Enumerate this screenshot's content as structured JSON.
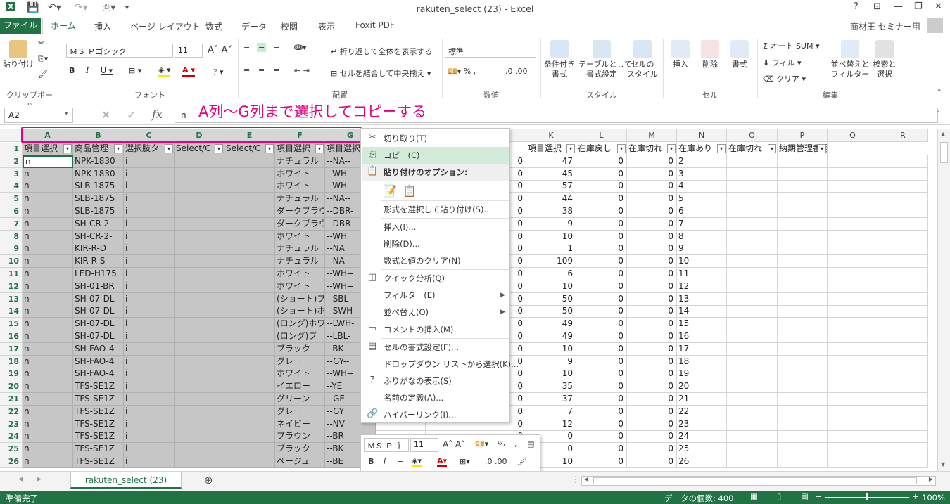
{
  "window": {
    "title": "rakuten_select (23) - Excel",
    "help": "?",
    "user": "商材王 セミナー用"
  },
  "tabs": [
    "ファイル",
    "ホーム",
    "挿入",
    "ページ レイアウト",
    "数式",
    "データ",
    "校閲",
    "表示",
    "Foxit PDF"
  ],
  "ribbon": {
    "paste": "貼り付け",
    "clipboard": "クリップボード",
    "font_name": "ＭＳ Ｐゴシック",
    "font_size": "11",
    "font": "フォント",
    "wrap": "折り返して全体を表示する",
    "merge": "セルを結合して中央揃え",
    "alignment": "配置",
    "number_format": "標準",
    "number": "数値",
    "cond_format": "条件付き\n書式",
    "table_format": "テーブルとして\n書式設定",
    "cell_style": "セルの\nスタイル",
    "styles": "スタイル",
    "insert": "挿入",
    "delete": "削除",
    "format": "書式",
    "cells": "セル",
    "autosum": "オート SUM",
    "fill": "フィル",
    "clear": "クリア",
    "sort": "並べ替えと\nフィルター",
    "find": "検索と\n選択",
    "editing": "編集"
  },
  "formula_bar": {
    "name_box": "A2",
    "value": "n",
    "fx": "fx"
  },
  "annotation": "A列～G列まで選択してコピーする",
  "columns": [
    "A",
    "B",
    "C",
    "D",
    "E",
    "F",
    "G",
    "H",
    "I",
    "J",
    "K",
    "L",
    "M",
    "N",
    "O",
    "P",
    "Q",
    "R"
  ],
  "header_row": [
    "項目選択",
    "商品管理",
    "選択肢タ",
    "Select/C",
    "Select/C",
    "項目選択",
    "項目選択",
    "",
    "",
    "",
    "項目選択",
    "在庫戻し",
    "在庫切れ",
    "在庫あり",
    "在庫切れ",
    "納期管理番号"
  ],
  "rows": [
    {
      "n": "2",
      "a": "n",
      "b": "NPK-1830",
      "c": "i",
      "f": "ナチュラル",
      "g": "--NA--",
      "j": "0",
      "k": "47",
      "l": "0",
      "m": "0"
    },
    {
      "n": "3",
      "a": "n",
      "b": "NPK-1830",
      "c": "i",
      "f": "ホワイト",
      "g": "--WH--",
      "j": "0",
      "k": "45",
      "l": "0",
      "m": "0"
    },
    {
      "n": "4",
      "a": "n",
      "b": "SLB-1875",
      "c": "i",
      "f": "ホワイト",
      "g": "--WH--",
      "j": "0",
      "k": "57",
      "l": "0",
      "m": "0"
    },
    {
      "n": "5",
      "a": "n",
      "b": "SLB-1875",
      "c": "i",
      "f": "ナチュラル",
      "g": "--NA--",
      "j": "0",
      "k": "44",
      "l": "0",
      "m": "0"
    },
    {
      "n": "6",
      "a": "n",
      "b": "SLB-1875",
      "c": "i",
      "f": "ダークブラウ",
      "g": "--DBR-",
      "j": "0",
      "k": "38",
      "l": "0",
      "m": "0"
    },
    {
      "n": "7",
      "a": "n",
      "b": "SH-CR-2-",
      "c": "i",
      "f": "ダークブラウ",
      "g": "--DBR",
      "j": "0",
      "k": "9",
      "l": "0",
      "m": "0"
    },
    {
      "n": "8",
      "a": "n",
      "b": "SH-CR-2-",
      "c": "i",
      "f": "ホワイト",
      "g": "--WH",
      "j": "0",
      "k": "10",
      "l": "0",
      "m": "0"
    },
    {
      "n": "9",
      "a": "n",
      "b": "KIR-R-D",
      "c": "i",
      "f": "ナチュラル",
      "g": "--NA",
      "j": "0",
      "k": "1",
      "l": "0",
      "m": "0"
    },
    {
      "n": "10",
      "a": "n",
      "b": "KIR-R-S",
      "c": "i",
      "f": "ナチュラル",
      "g": "--NA",
      "j": "0",
      "k": "109",
      "l": "0",
      "m": "0"
    },
    {
      "n": "11",
      "a": "n",
      "b": "LED-H175",
      "c": "i",
      "f": "ホワイト",
      "g": "--WH--",
      "j": "0",
      "k": "6",
      "l": "0",
      "m": "0"
    },
    {
      "n": "12",
      "a": "n",
      "b": "SH-01-BR",
      "c": "i",
      "f": "ホワイト",
      "g": "--WH--",
      "j": "0",
      "k": "10",
      "l": "0",
      "m": "0"
    },
    {
      "n": "13",
      "a": "n",
      "b": "SH-07-DL",
      "c": "i",
      "f": "(ショート)ブ",
      "g": "--SBL-",
      "j": "0",
      "k": "50",
      "l": "0",
      "m": "0"
    },
    {
      "n": "14",
      "a": "n",
      "b": "SH-07-DL",
      "c": "i",
      "f": "(ショート)ホ",
      "g": "--SWH-",
      "j": "0",
      "k": "50",
      "l": "0",
      "m": "0"
    },
    {
      "n": "15",
      "a": "n",
      "b": "SH-07-DL",
      "c": "i",
      "f": "(ロング)ホワ",
      "g": "--LWH-",
      "j": "0",
      "k": "49",
      "l": "0",
      "m": "0"
    },
    {
      "n": "16",
      "a": "n",
      "b": "SH-07-DL",
      "c": "i",
      "f": "(ロング)ブ",
      "g": "--LBL-",
      "j": "0",
      "k": "49",
      "l": "0",
      "m": "0"
    },
    {
      "n": "17",
      "a": "n",
      "b": "SH-FAO-4",
      "c": "i",
      "f": "ブラック",
      "g": "--BK--",
      "j": "0",
      "k": "10",
      "l": "0",
      "m": "0"
    },
    {
      "n": "18",
      "a": "n",
      "b": "SH-FAO-4",
      "c": "i",
      "f": "グレー",
      "g": "--GY--",
      "j": "0",
      "k": "9",
      "l": "0",
      "m": "0"
    },
    {
      "n": "19",
      "a": "n",
      "b": "SH-FAO-4",
      "c": "i",
      "f": "ホワイト",
      "g": "--WH--",
      "j": "0",
      "k": "10",
      "l": "0",
      "m": "0"
    },
    {
      "n": "20",
      "a": "n",
      "b": "TFS-SE1Z",
      "c": "i",
      "f": "イエロー",
      "g": "--YE",
      "j": "0",
      "k": "35",
      "l": "0",
      "m": "0"
    },
    {
      "n": "21",
      "a": "n",
      "b": "TFS-SE1Z",
      "c": "i",
      "f": "グリーン",
      "g": "--GE",
      "j": "0",
      "k": "37",
      "l": "0",
      "m": "0"
    },
    {
      "n": "22",
      "a": "n",
      "b": "TFS-SE1Z",
      "c": "i",
      "f": "グレー",
      "g": "--GY",
      "j": "0",
      "k": "7",
      "l": "0",
      "m": "0"
    },
    {
      "n": "23",
      "a": "n",
      "b": "TFS-SE1Z",
      "c": "i",
      "f": "ネイビー",
      "g": "--NV",
      "j": "0",
      "k": "12",
      "l": "0",
      "m": "0"
    },
    {
      "n": "24",
      "a": "n",
      "b": "TFS-SE1Z",
      "c": "i",
      "f": "ブラウン",
      "g": "--BR",
      "j": "0",
      "k": "0",
      "l": "0",
      "m": "0"
    },
    {
      "n": "25",
      "a": "n",
      "b": "TFS-SE1Z",
      "c": "i",
      "f": "ブラック",
      "g": "--BK",
      "j": "0",
      "k": "0",
      "l": "0",
      "m": "0"
    },
    {
      "n": "26",
      "a": "n",
      "b": "TFS-SE1Z",
      "c": "i",
      "f": "ベージュ",
      "g": "--BE",
      "j": "0",
      "k": "10",
      "l": "0",
      "m": "0"
    }
  ],
  "context_menu": [
    {
      "label": "切り取り(T)",
      "icon": "scissors-icon",
      "glyph": "✂"
    },
    {
      "label": "コピー(C)",
      "icon": "copy-icon",
      "glyph": "⎘",
      "highlight": true
    },
    {
      "label": "貼り付けのオプション:",
      "icon": "paste-icon",
      "glyph": "📋",
      "bold": true
    },
    {
      "label": "",
      "icon": "paste-options",
      "glyph": ""
    },
    {
      "label": "形式を選択して貼り付け(S)...",
      "icon": "",
      "glyph": "",
      "sep_before": true
    },
    {
      "label": "挿入(I)...",
      "icon": "",
      "glyph": "",
      "sep_before": true
    },
    {
      "label": "削除(D)...",
      "icon": "",
      "glyph": ""
    },
    {
      "label": "数式と値のクリア(N)",
      "icon": "",
      "glyph": ""
    },
    {
      "label": "クイック分析(Q)",
      "icon": "quick-analysis-icon",
      "glyph": "◫",
      "sep_before": true
    },
    {
      "label": "フィルター(E)",
      "icon": "",
      "glyph": "",
      "submenu": true
    },
    {
      "label": "並べ替え(O)",
      "icon": "",
      "glyph": "",
      "submenu": true
    },
    {
      "label": "コメントの挿入(M)",
      "icon": "comment-icon",
      "glyph": "▭",
      "sep_before": true
    },
    {
      "label": "セルの書式設定(F)...",
      "icon": "format-cells-icon",
      "glyph": "▤",
      "sep_before": true
    },
    {
      "label": "ドロップダウン リストから選択(K)...",
      "icon": "",
      "glyph": ""
    },
    {
      "label": "ふりがなの表示(S)",
      "icon": "furigana-icon",
      "glyph": "ｱ"
    },
    {
      "label": "名前の定義(A)...",
      "icon": "",
      "glyph": ""
    },
    {
      "label": "ハイパーリンク(I)...",
      "icon": "hyperlink-icon",
      "glyph": "🔗"
    }
  ],
  "mini_toolbar": {
    "font": "ＭＳ Ｐゴ",
    "size": "11"
  },
  "sheet": {
    "name": "rakuten_select (23)"
  },
  "status": {
    "ready": "準備完了",
    "count": "データの個数: 400",
    "zoom": "100%"
  },
  "colors": {
    "accent": "#217346",
    "annotation": "#e6007e",
    "highlight": "#d3ebd9"
  }
}
